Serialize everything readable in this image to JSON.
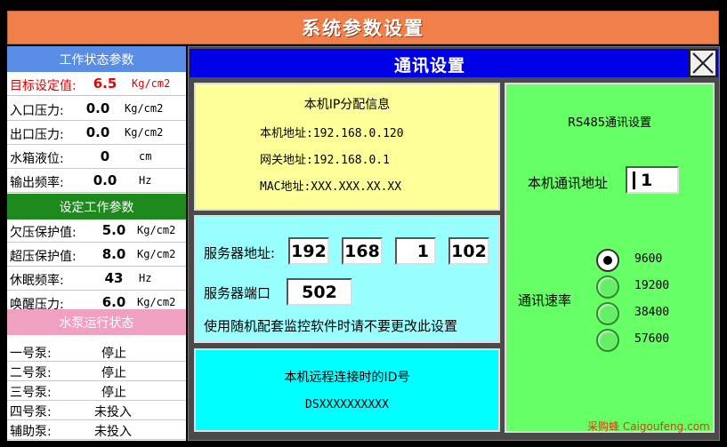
{
  "header": {
    "title": "系统参数设置"
  },
  "left": {
    "work_status": {
      "title": "工作状态参数",
      "rows": [
        {
          "label": "目标设定值:",
          "value": "6.5",
          "unit": "Kg/cm2"
        },
        {
          "label": "入口压力:",
          "value": "0.0",
          "unit": "Kg/cm2"
        },
        {
          "label": "出口压力:",
          "value": "0.0",
          "unit": "Kg/cm2"
        },
        {
          "label": "水箱液位:",
          "value": "0",
          "unit": "cm"
        },
        {
          "label": "输出频率:",
          "value": "0.0",
          "unit": "Hz"
        }
      ]
    },
    "settings": {
      "title": "设定工作参数",
      "rows": [
        {
          "label": "欠压保护值:",
          "value": "5.0",
          "unit": "Kg/cm2"
        },
        {
          "label": "超压保护值:",
          "value": "8.0",
          "unit": "Kg/cm2"
        },
        {
          "label": "休眠频率:",
          "value": "43",
          "unit": "Hz"
        },
        {
          "label": "唤醒压力:",
          "value": "6.0",
          "unit": "Kg/cm2"
        }
      ]
    },
    "pumps": {
      "title": "水泵运行状态",
      "rows": [
        {
          "label": "一号泵:",
          "status": "停止"
        },
        {
          "label": "二号泵:",
          "status": "停止"
        },
        {
          "label": "三号泵:",
          "status": "停止"
        },
        {
          "label": "四号泵:",
          "status": "未投入"
        },
        {
          "label": "辅助泵:",
          "status": "未投入"
        }
      ]
    }
  },
  "dialog": {
    "title": "通讯设置",
    "close_icon": "close-x-icon",
    "ip_info": {
      "title": "本机IP分配信息",
      "local_addr": "本机地址:192.168.0.120",
      "gateway": "网关地址:192.168.0.1",
      "mac": "MAC地址:XXX.XXX.XX.XX"
    },
    "server": {
      "addr_label": "服务器地址:",
      "addr": [
        "192",
        "168",
        "1",
        "102"
      ],
      "port_label": "服务器端口",
      "port": "502",
      "note": "使用随机配套监控软件时请不要更改此设置"
    },
    "remote_id": {
      "title": "本机远程连接时的ID号",
      "id": "DSXXXXXXXXXX"
    },
    "rs485": {
      "title": "RS485通讯设置",
      "addr_label": "本机通讯地址",
      "addr": "1",
      "rate_label": "通讯速率",
      "rates": [
        "9600",
        "19200",
        "38400",
        "57600"
      ],
      "selected_rate": "9600"
    }
  },
  "watermark": "采购蜂 Caigoufeng.com",
  "colors": {
    "header_bg": "#f07f4a",
    "section_blue": "#5a8ee6",
    "section_green": "#1e8a1e",
    "section_pink": "#f0a0c0",
    "dialog_title_bg": "#0000e6",
    "ip_box": "#ffff99",
    "server_box": "#99ffff",
    "id_box": "#00ffff",
    "rs485_box": "#66ff66"
  }
}
